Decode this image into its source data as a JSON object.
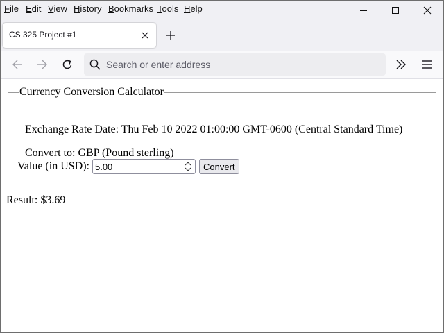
{
  "menu": {
    "items": [
      {
        "label": "File",
        "key": "F",
        "rest": "ile"
      },
      {
        "label": "Edit",
        "key": "E",
        "rest": "dit"
      },
      {
        "label": "View",
        "key": "V",
        "rest": "iew"
      },
      {
        "label": "History",
        "key": "H",
        "rest": "istory"
      },
      {
        "label": "Bookmarks",
        "key": "B",
        "rest": "ookmarks"
      },
      {
        "label": "Tools",
        "key": "T",
        "rest": "ools"
      },
      {
        "label": "Help",
        "key": "H",
        "rest": "elp"
      }
    ]
  },
  "window_controls": {
    "icons": [
      "minimize-icon",
      "maximize-icon",
      "close-icon"
    ]
  },
  "tab": {
    "title": "CS 325 Project #1",
    "close_icon": "close-icon"
  },
  "new_tab_icon": "plus-icon",
  "nav": {
    "back_icon": "arrow-left-icon",
    "forward_icon": "arrow-right-icon",
    "reload_icon": "reload-icon",
    "address_placeholder": "Search or enter address",
    "overflow_icon": "double-chevron-right-icon",
    "menu_icon": "hamburger-icon"
  },
  "page": {
    "legend": "Currency Conversion Calculator",
    "exchange_rate_date": "Exchange Rate Date: Thu Feb 10 2022 01:00:00 GMT-0600 (Central Standard Time)",
    "convert_to": "Convert to: GBP (Pound sterling)",
    "value_label": "Value (in USD):",
    "value_input": "5.00",
    "convert_button": "Convert",
    "result": "Result: $3.69"
  },
  "colors": {
    "chrome_bg": "#f0f0f4",
    "navbar_bg": "#f9f9fb",
    "urlbar_bg": "#ededf0",
    "button_bg": "#e9e9ed"
  }
}
